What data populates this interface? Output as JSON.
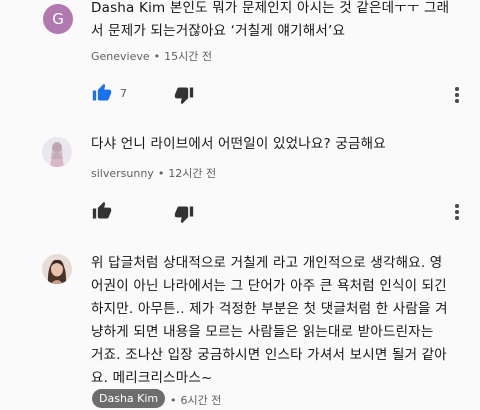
{
  "comments": [
    {
      "avatar_letter": "G",
      "author": "Dasha Kim",
      "line1": "본인도 뭐가 문제인지 아시는 것 같은데ㅜㅜ 그래",
      "line2": "서 문제가 되는거잖아요 ‘거칠게 얘기해서’요",
      "username": "Genevieve",
      "time": "15시간 전",
      "likes": "7"
    },
    {
      "text": "다샤 언니 라이브에서 어떤일이 있었나요? 궁금해요",
      "username": "silversunny",
      "time": "12시간 전"
    },
    {
      "lines": [
        "위 답글처럼 상대적으로 거칠게 라고 개인적으로 생각해요. 영",
        "어권이 아닌 나라에서는 그 단어가 아주 큰 욕처럼 인식이 되긴",
        "하지만. 아무튼.. 제가 걱정한 부분은 첫 댓글처럼 한 사람을 겨",
        "냥하게 되면 내용을 모르는 사람들은 읽는대로 받아드린자는",
        "거죠. 조나산 입장 궁금하시면 인스타 가셔서 보시면 될거 같아",
        "요. 메리크리스마스~"
      ],
      "username": "Dasha Kim",
      "time": "6시간 전"
    }
  ],
  "colors": {
    "like_active": "#1a73e8",
    "icon": "#333333",
    "badge": "#6d6d6d"
  }
}
